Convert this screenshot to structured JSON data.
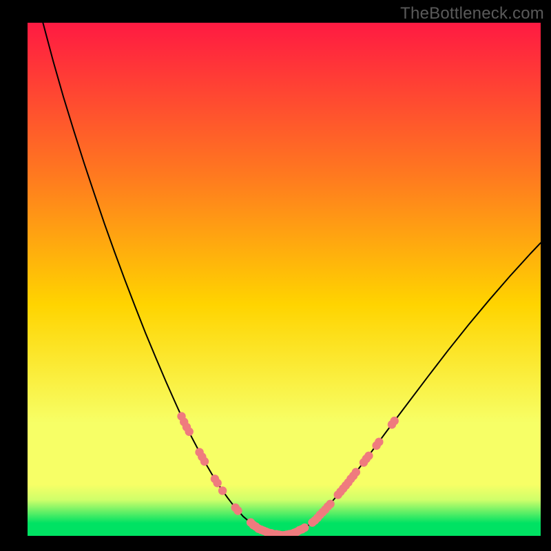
{
  "watermark": "TheBottleneck.com",
  "colors": {
    "gradient_top": "#ff1a42",
    "gradient_mid_upper": "#ff7a1f",
    "gradient_mid": "#ffd400",
    "gradient_lower": "#f7ff66",
    "gradient_floor_band": "#cfff6a",
    "gradient_bottom": "#00e263",
    "curve": "#000000",
    "markers": "#ef7b7e"
  },
  "chart_data": {
    "type": "line",
    "xlabel": "",
    "ylabel": "",
    "xlim": [
      0,
      100
    ],
    "ylim": [
      0,
      100
    ],
    "series": [
      {
        "name": "bottleneck-curve",
        "x": [
          3,
          5,
          7,
          9,
          11,
          13,
          15,
          17,
          19,
          21,
          23,
          25,
          27,
          29,
          30,
          31,
          32,
          33,
          34,
          35,
          36,
          37,
          38,
          39,
          40,
          42,
          44,
          46,
          48,
          50,
          52,
          55,
          58,
          62,
          66,
          70,
          74,
          78,
          82,
          86,
          90,
          94,
          98,
          100
        ],
        "y": [
          100,
          92.5,
          85.5,
          79,
          72.7,
          66.7,
          60.8,
          55.2,
          49.8,
          44.6,
          39.5,
          34.7,
          30,
          25.5,
          23.3,
          21.2,
          19.2,
          17.3,
          15.4,
          13.6,
          11.9,
          10.3,
          8.8,
          7.4,
          6.1,
          3.8,
          2.1,
          1,
          0.3,
          0.1,
          0.6,
          2.2,
          5.1,
          9.8,
          15,
          20.4,
          25.7,
          31,
          36.2,
          41.2,
          46,
          50.6,
          55,
          57.1
        ]
      }
    ],
    "markers": {
      "name": "highlight-dots",
      "points": [
        {
          "x": 30.0,
          "y": 23.3
        },
        {
          "x": 30.5,
          "y": 22.2
        },
        {
          "x": 31.0,
          "y": 21.2
        },
        {
          "x": 31.5,
          "y": 20.3
        },
        {
          "x": 33.5,
          "y": 16.3
        },
        {
          "x": 34.0,
          "y": 15.4
        },
        {
          "x": 34.5,
          "y": 14.5
        },
        {
          "x": 36.5,
          "y": 11.1
        },
        {
          "x": 37.0,
          "y": 10.3
        },
        {
          "x": 38.0,
          "y": 8.8
        },
        {
          "x": 40.5,
          "y": 5.5
        },
        {
          "x": 41.0,
          "y": 4.9
        },
        {
          "x": 43.5,
          "y": 2.6
        },
        {
          "x": 44.0,
          "y": 2.1
        },
        {
          "x": 44.5,
          "y": 1.8
        },
        {
          "x": 45.0,
          "y": 1.4
        },
        {
          "x": 45.5,
          "y": 1.2
        },
        {
          "x": 46.0,
          "y": 1.0
        },
        {
          "x": 46.5,
          "y": 0.8
        },
        {
          "x": 47.0,
          "y": 0.6
        },
        {
          "x": 47.5,
          "y": 0.5
        },
        {
          "x": 48.0,
          "y": 0.3
        },
        {
          "x": 48.5,
          "y": 0.3
        },
        {
          "x": 49.0,
          "y": 0.2
        },
        {
          "x": 49.5,
          "y": 0.1
        },
        {
          "x": 50.0,
          "y": 0.1
        },
        {
          "x": 50.5,
          "y": 0.2
        },
        {
          "x": 51.0,
          "y": 0.3
        },
        {
          "x": 51.5,
          "y": 0.4
        },
        {
          "x": 52.0,
          "y": 0.6
        },
        {
          "x": 52.5,
          "y": 0.8
        },
        {
          "x": 53.0,
          "y": 1.1
        },
        {
          "x": 53.5,
          "y": 1.3
        },
        {
          "x": 54.0,
          "y": 1.6
        },
        {
          "x": 55.5,
          "y": 2.6
        },
        {
          "x": 56.0,
          "y": 3.0
        },
        {
          "x": 56.5,
          "y": 3.5
        },
        {
          "x": 57.0,
          "y": 4.1
        },
        {
          "x": 57.5,
          "y": 4.6
        },
        {
          "x": 58.0,
          "y": 5.1
        },
        {
          "x": 58.5,
          "y": 5.7
        },
        {
          "x": 59.0,
          "y": 6.2
        },
        {
          "x": 60.5,
          "y": 8.0
        },
        {
          "x": 61.0,
          "y": 8.6
        },
        {
          "x": 61.5,
          "y": 9.2
        },
        {
          "x": 62.0,
          "y": 9.8
        },
        {
          "x": 62.5,
          "y": 10.4
        },
        {
          "x": 63.0,
          "y": 11.1
        },
        {
          "x": 63.5,
          "y": 11.7
        },
        {
          "x": 64.0,
          "y": 12.4
        },
        {
          "x": 65.5,
          "y": 14.3
        },
        {
          "x": 66.0,
          "y": 15.0
        },
        {
          "x": 66.5,
          "y": 15.6
        },
        {
          "x": 68.0,
          "y": 17.6
        },
        {
          "x": 68.5,
          "y": 18.3
        },
        {
          "x": 71.0,
          "y": 21.7
        },
        {
          "x": 71.5,
          "y": 22.4
        }
      ]
    }
  }
}
